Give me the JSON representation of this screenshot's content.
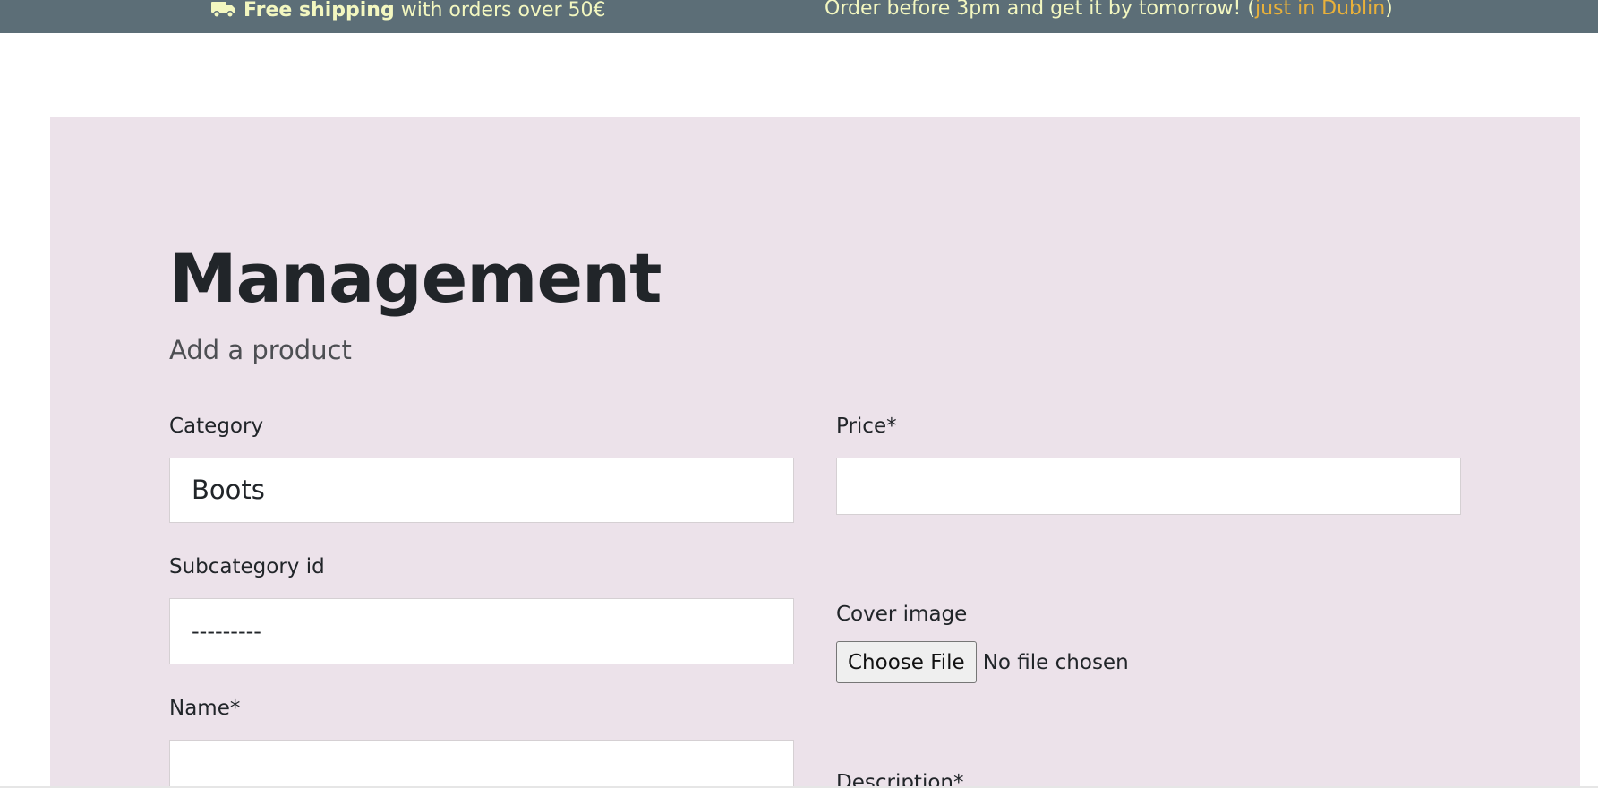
{
  "topbar": {
    "shipping_bold": "Free shipping",
    "shipping_rest": " with orders over 50€",
    "delivery_text": "Order before 3pm and get it by tomorrow! (",
    "delivery_accent": "just in Dublin",
    "delivery_close": ")",
    "truck_icon": "truck-icon"
  },
  "page": {
    "title": "Management",
    "subtitle": "Add a product"
  },
  "form": {
    "category_label": "Category",
    "category_value": "Boots",
    "subcategory_label": "Subcategory id",
    "subcategory_value": "---------",
    "name_label": "Name*",
    "name_value": "",
    "price_label": "Price*",
    "price_value": "",
    "cover_image_label": "Cover image",
    "choose_file_label": "Choose File",
    "file_status": "No file chosen",
    "description_label": "Description*"
  },
  "colors": {
    "topbar_bg": "#5c6e77",
    "topbar_text": "#f3f7c0",
    "accent": "#e9b13a",
    "panel_bg": "#ece2ea"
  }
}
